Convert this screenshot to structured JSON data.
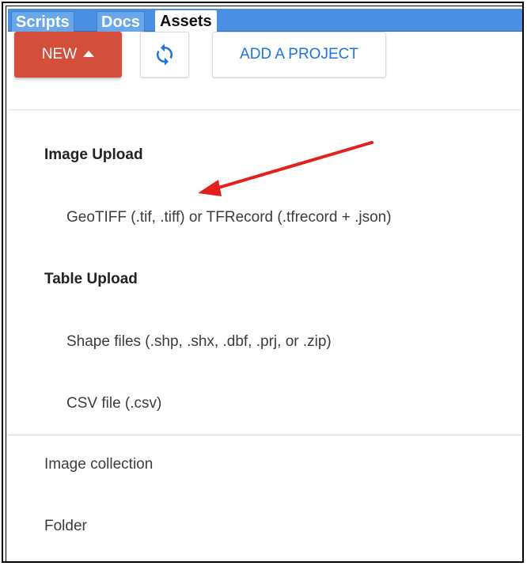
{
  "tabs": [
    {
      "label": "Scripts",
      "active": false
    },
    {
      "label": "Docs",
      "active": false
    },
    {
      "label": "Assets",
      "active": true
    }
  ],
  "toolbar": {
    "new_label": "NEW",
    "add_project_label": "ADD A PROJECT",
    "refresh_icon": "refresh-icon",
    "new_color": "#d34e3b",
    "accent_color": "#1a73e8"
  },
  "menu": {
    "image_upload_header": "Image Upload",
    "geotiff_item": "GeoTIFF (.tif, .tiff) or TFRecord (.tfrecord + .json)",
    "table_upload_header": "Table Upload",
    "shape_files_item": "Shape files (.shp, .shx, .dbf, .prj, or .zip)",
    "csv_item": "CSV file (.csv)",
    "image_collection_item": "Image collection",
    "folder_item": "Folder"
  },
  "annotation": {
    "arrow_color": "#e3201b"
  }
}
